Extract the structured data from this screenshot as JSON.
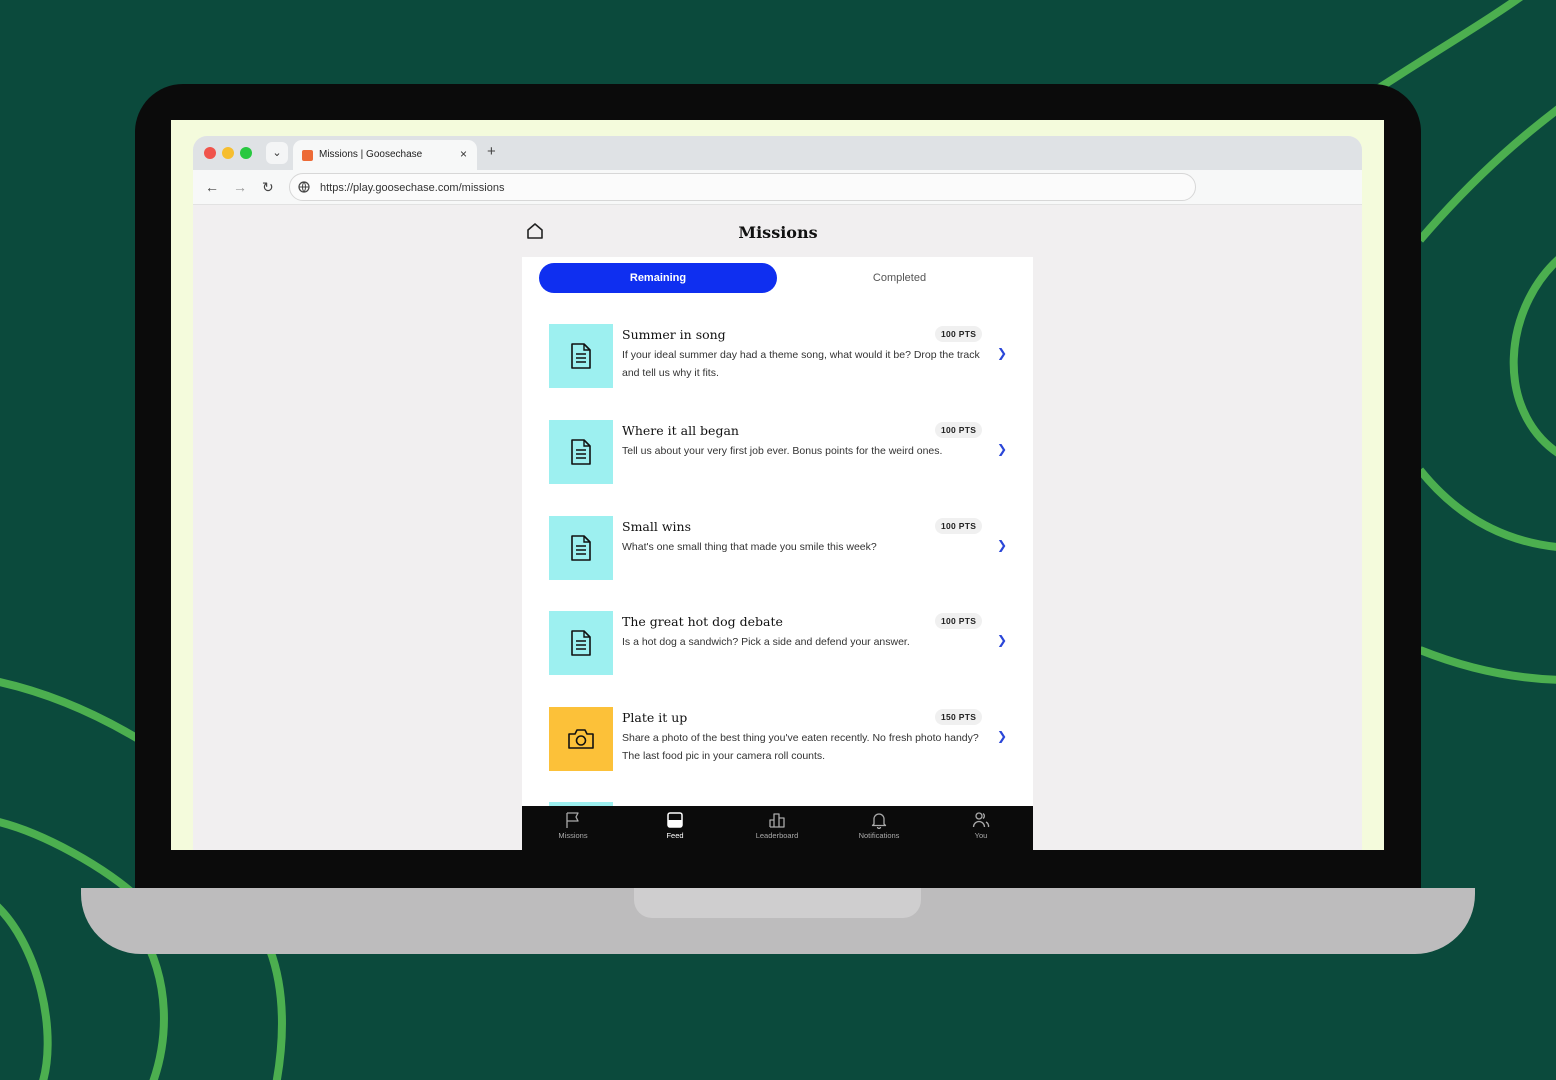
{
  "colors": {
    "background": "#0b4a3c",
    "decor_stroke": "#4caf4f",
    "accent_blue": "#0f2ff0",
    "doc_icon_bg": "#9df0f0",
    "camera_icon_bg": "#fcc139"
  },
  "browser": {
    "tab_title": "Missions | Goosechase",
    "tab_close": "×",
    "new_tab": "+",
    "url": "https://play.goosechase.com/missions",
    "back": "←",
    "forward": "→",
    "reload": "↻",
    "tab_dropdown": "⌄"
  },
  "app": {
    "title": "Missions",
    "tabs": {
      "remaining": "Remaining",
      "completed": "Completed"
    },
    "missions": [
      {
        "title": "Summer in song",
        "points": "100 PTS",
        "description": "If your ideal summer day had a theme song, what would it be? Drop the track and tell us why it fits.",
        "icon": "document-icon"
      },
      {
        "title": "Where it all began",
        "points": "100 PTS",
        "description": "Tell us about your very first job ever. Bonus points for the weird ones.",
        "icon": "document-icon"
      },
      {
        "title": "Small wins",
        "points": "100 PTS",
        "description": "What's one small thing that made you smile this week?",
        "icon": "document-icon"
      },
      {
        "title": "The great hot dog debate",
        "points": "100 PTS",
        "description": "Is a hot dog a sandwich? Pick a side and defend your answer.",
        "icon": "document-icon"
      },
      {
        "title": "Plate it up",
        "points": "150 PTS",
        "description": "Share a photo of the best thing you've eaten recently. No fresh photo handy? The last food pic in your camera roll counts.",
        "icon": "camera-icon"
      }
    ],
    "bottom_nav": [
      {
        "label": "Missions",
        "icon": "flag-icon"
      },
      {
        "label": "Feed",
        "icon": "feed-icon",
        "active": true
      },
      {
        "label": "Leaderboard",
        "icon": "leaderboard-icon"
      },
      {
        "label": "Notifications",
        "icon": "bell-icon"
      },
      {
        "label": "You",
        "icon": "users-icon"
      }
    ]
  }
}
